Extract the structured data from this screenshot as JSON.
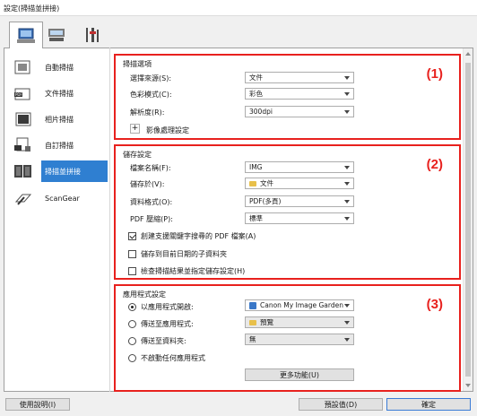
{
  "window": {
    "title": "設定(掃描並拼接)"
  },
  "tabs": [
    {
      "icon": "scan-from-computer-icon"
    },
    {
      "icon": "scan-from-operation-panel-icon"
    },
    {
      "icon": "general-settings-icon"
    }
  ],
  "sidebar": {
    "items": [
      {
        "label": "自動掃描",
        "icon": "auto-scan-icon"
      },
      {
        "label": "文件掃描",
        "icon": "document-scan-icon"
      },
      {
        "label": "相片掃描",
        "icon": "photo-scan-icon"
      },
      {
        "label": "自訂掃描",
        "icon": "custom-scan-icon"
      },
      {
        "label": "掃描並拼接",
        "icon": "scan-and-stitch-icon",
        "selected": true
      },
      {
        "label": "ScanGear",
        "icon": "scangear-icon"
      }
    ]
  },
  "scan_options": {
    "title": "掃描選項",
    "number": "(1)",
    "source_label": "選擇來源(S):",
    "source_value": "文件",
    "color_label": "色彩模式(C):",
    "color_value": "彩色",
    "resolution_label": "解析度(R):",
    "resolution_value": "300dpi",
    "image_processing_label": "影像處理設定",
    "expand_symbol": "+"
  },
  "save_settings": {
    "title": "儲存設定",
    "number": "(2)",
    "filename_label": "檔案名稱(F):",
    "filename_value": "IMG",
    "save_in_label": "儲存於(V):",
    "save_in_value": "文件",
    "format_label": "資料格式(O):",
    "format_value": "PDF(多頁)",
    "pdf_compression_label": "PDF 壓縮(P):",
    "pdf_compression_value": "標準",
    "checkbox_searchable": "創建支援關鍵字搜尋的 PDF 檔案(A)",
    "checkbox_subfolder": "儲存到目前日期的子資料夾",
    "checkbox_check_results": "檢查掃描結果並指定儲存設定(H)"
  },
  "app_settings": {
    "title": "應用程式設定",
    "number": "(3)",
    "radio_open_with": "以應用程式開啟:",
    "open_with_value": "Canon My Image Garden",
    "radio_send_to_app": "傳送至應用程式:",
    "send_to_app_value": "預覽",
    "radio_send_to_folder": "傳送至資料夾:",
    "send_to_folder_value": "無",
    "radio_no_app": "不啟動任何應用程式",
    "more_functions": "更多功能(U)"
  },
  "footer": {
    "help": "使用說明(I)",
    "defaults": "預設值(D)",
    "ok": "確定"
  },
  "colors": {
    "highlight": "#e8211e",
    "selection": "#2f7fd1"
  }
}
